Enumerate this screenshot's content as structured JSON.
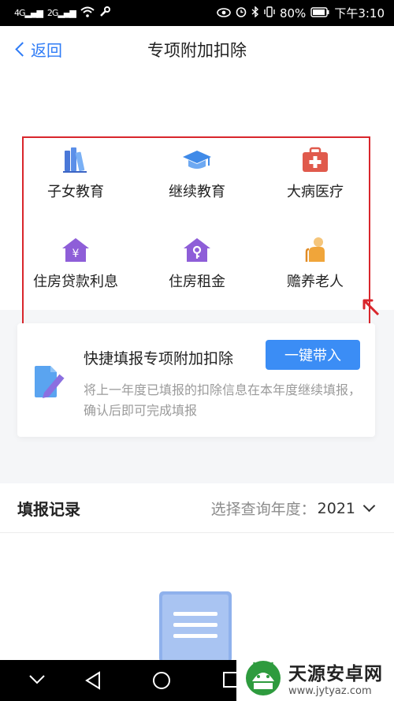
{
  "status_bar": {
    "signal1": "4G",
    "signal2": "2G",
    "battery": "80%",
    "time": "下午3:10"
  },
  "nav": {
    "back_label": "返回",
    "title": "专项附加扣除"
  },
  "categories": [
    {
      "label": "子女教育",
      "icon": "books-icon"
    },
    {
      "label": "继续教育",
      "icon": "graduation-cap-icon"
    },
    {
      "label": "大病医疗",
      "icon": "medical-kit-icon"
    },
    {
      "label": "住房贷款利息",
      "icon": "house-yuan-icon"
    },
    {
      "label": "住房租金",
      "icon": "house-key-icon"
    },
    {
      "label": "赡养老人",
      "icon": "elderly-person-icon"
    }
  ],
  "quick_fill": {
    "title": "快捷填报专项附加扣除",
    "button": "一键带入",
    "description": "将上一年度已填报的扣除信息在本年度继续填报，确认后即可完成填报"
  },
  "records": {
    "title": "填报记录",
    "year_label": "选择查询年度：",
    "year_value": "2021"
  },
  "watermark": {
    "name": "天源安卓网",
    "url": "www.jytyaz.com"
  },
  "colors": {
    "accent": "#3b8df5",
    "highlight": "#d9262c"
  }
}
